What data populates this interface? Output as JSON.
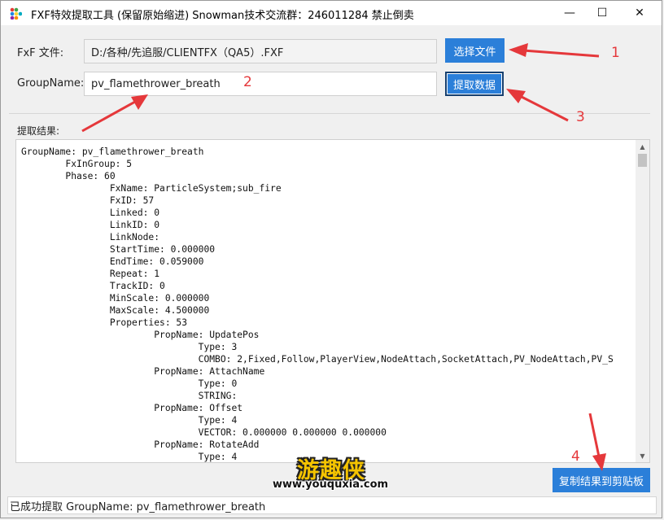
{
  "window": {
    "title": "FXF特效提取工具 (保留原始缩进)  Snowman技术交流群：246011284  禁止倒卖",
    "controls": {
      "minimize": "—",
      "maximize": "☐",
      "close": "✕"
    }
  },
  "form": {
    "fxf_label": "FxF 文件:",
    "fxf_value": "D:/各种/先追服/CLIENTFX（QA5）.FXF",
    "select_button": "选择文件",
    "group_label": "GroupName:",
    "group_value": "pv_flamethrower_breath",
    "extract_button": "提取数据",
    "result_label": "提取结果:"
  },
  "result": {
    "lines": [
      "GroupName: pv_flamethrower_breath",
      "        FxInGroup: 5",
      "        Phase: 60",
      "                FxName: ParticleSystem;sub_fire",
      "                FxID: 57",
      "                Linked: 0",
      "                LinkID: 0",
      "                LinkNode:",
      "                StartTime: 0.000000",
      "                EndTime: 0.059000",
      "                Repeat: 1",
      "                TrackID: 0",
      "                MinScale: 0.000000",
      "                MaxScale: 4.500000",
      "                Properties: 53",
      "                        PropName: UpdatePos",
      "                                Type: 3",
      "                                COMBO: 2,Fixed,Follow,PlayerView,NodeAttach,SocketAttach,PV_NodeAttach,PV_S",
      "                        PropName: AttachName",
      "                                Type: 0",
      "                                STRING:",
      "                        PropName: Offset",
      "                                Type: 4",
      "                                VECTOR: 0.000000 0.000000 0.000000",
      "                        PropName: RotateAdd",
      "                                Type: 4"
    ]
  },
  "copy_button": "复制结果到剪贴板",
  "status": "已成功提取 GroupName: pv_flamethrower_breath",
  "annotations": [
    "1",
    "2",
    "3",
    "4"
  ],
  "watermark": {
    "main": "游趣侠",
    "sub": "www.youquxia.com"
  },
  "colors": {
    "accent": "#2b7fd9",
    "annotation": "#e5383b",
    "watermark": "#f5c400"
  }
}
